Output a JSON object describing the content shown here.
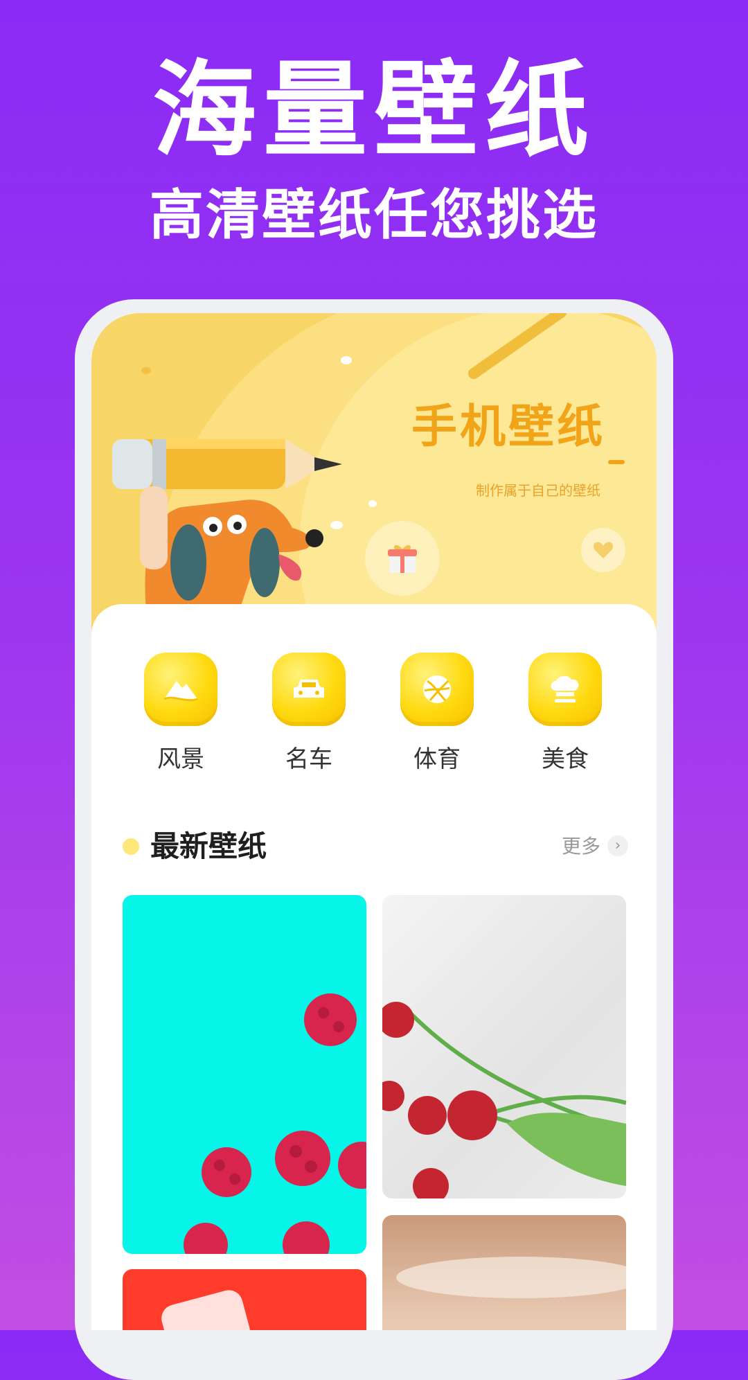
{
  "promo": {
    "headline": "海量壁纸",
    "subheadline": "高清壁纸任您挑选"
  },
  "banner": {
    "title": "手机壁纸",
    "subtitle": "制作属于自己的壁纸",
    "gift_icon": "gift-icon",
    "favorite_icon": "heart-icon"
  },
  "categories": [
    {
      "label": "风景",
      "icon": "landscape-icon"
    },
    {
      "label": "名车",
      "icon": "car-icon"
    },
    {
      "label": "体育",
      "icon": "sports-ball-icon"
    },
    {
      "label": "美食",
      "icon": "chef-hat-icon"
    }
  ],
  "latest": {
    "title": "最新壁纸",
    "more_label": "更多"
  },
  "colors": {
    "background_top": "#8a2bf5",
    "background_bottom": "#c24fe3",
    "banner": "#f8d567",
    "accent_yellow": "#ffd90f"
  }
}
